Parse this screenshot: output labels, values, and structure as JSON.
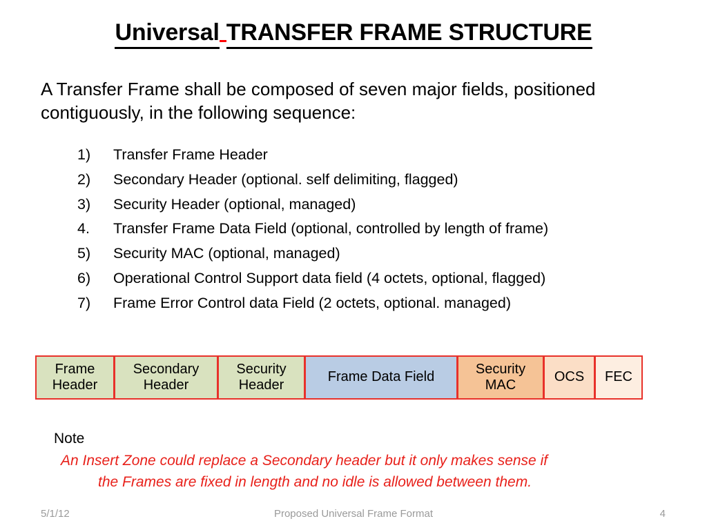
{
  "slide": {
    "title_part1": "Universal",
    "title_part2": "TRANSFER FRAME STRUCTURE",
    "intro": "A Transfer Frame shall be composed of seven major fields, positioned contiguously, in the following sequence:",
    "accent_red": "#ff0000",
    "border_red": "#e8312a"
  },
  "fields": [
    {
      "marker": "1)",
      "text": "Transfer Frame Header"
    },
    {
      "marker": "2)",
      "text": "Secondary Header (optional. self delimiting, flagged)"
    },
    {
      "marker": "3)",
      "text": "Security Header (optional, managed)"
    },
    {
      "marker": "4.",
      "text": "Transfer Frame Data Field (optional, controlled by length of frame)"
    },
    {
      "marker": "5)",
      "text": "Security MAC (optional, managed)"
    },
    {
      "marker": "6)",
      "text": "Operational Control Support data field (4 octets, optional, flagged)"
    },
    {
      "marker": "7)",
      "text": "Frame Error Control data Field (2 octets, optional. managed)"
    }
  ],
  "diagram": {
    "boxes": [
      {
        "label": "Frame Header",
        "color": "#d9e2bf"
      },
      {
        "label": "Secondary Header",
        "color": "#d9e2bf"
      },
      {
        "label": "Security Header",
        "color": "#d9e2bf"
      },
      {
        "label": "Frame Data Field",
        "color": "#b9cce4"
      },
      {
        "label": "Security MAC",
        "color": "#f5c396"
      },
      {
        "label": "OCS",
        "color": "#fbdec6"
      },
      {
        "label": "FEC",
        "color": "#fdeee1"
      }
    ]
  },
  "note": {
    "label": "Note",
    "line1": "An Insert Zone could replace a Secondary header but it only makes sense if",
    "line2": "the Frames are fixed in length and no idle is allowed between them.",
    "color": "#e8201a"
  },
  "footer": {
    "date": "5/1/12",
    "center": "Proposed Universal Frame Format",
    "page": "4"
  }
}
